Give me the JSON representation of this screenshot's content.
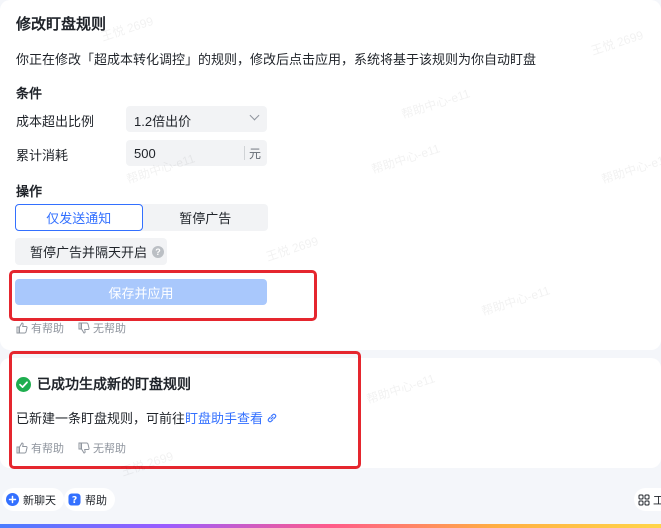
{
  "rule_card": {
    "title": "修改盯盘规则",
    "description": "你正在修改「超成本转化调控」的规则，修改后点击应用，系统将基于该规则为你自动盯盘",
    "conditions": {
      "heading": "条件",
      "cost_ratio_label": "成本超出比例",
      "cost_ratio_value": "1.2倍出价",
      "cumulative_label": "累计消耗",
      "cumulative_value": "500",
      "cumulative_unit": "元"
    },
    "actions": {
      "heading": "操作",
      "options": [
        "仅发送通知",
        "暂停广告"
      ],
      "selected": "仅发送通知",
      "extra_option": "暂停广告并隔天开启",
      "help_glyph": "?"
    },
    "save_button": "保存并应用",
    "feedback": {
      "helpful": "有帮助",
      "unhelpful": "无帮助"
    }
  },
  "success_card": {
    "title": "已成功生成新的盯盘规则",
    "text": "已新建一条盯盘规则，可前往",
    "link": "盯盘助手查看",
    "feedback": {
      "helpful": "有帮助",
      "unhelpful": "无帮助"
    }
  },
  "bottom_bar": {
    "new_chat": "新聊天",
    "help": "帮助",
    "right_label": "工"
  },
  "watermarks": [
    "王悦 2699",
    "帮助中心-e11"
  ],
  "colors": {
    "accent": "#3370ff",
    "highlight": "#e5262e",
    "success": "#1fae4f",
    "save_disabled": "#a9c8fc"
  },
  "icons": [
    "chevron-down-icon",
    "question-icon",
    "thumbs-up-icon",
    "thumbs-down-icon",
    "check-circle-icon",
    "link-icon",
    "plus-circle-icon",
    "help-icon",
    "grid-icon"
  ]
}
